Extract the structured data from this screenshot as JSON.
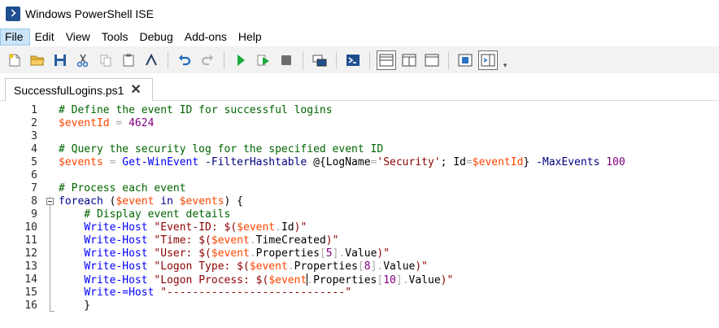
{
  "window": {
    "title": "Windows PowerShell ISE"
  },
  "menu": [
    "File",
    "Edit",
    "View",
    "Tools",
    "Debug",
    "Add-ons",
    "Help"
  ],
  "toolbar": {
    "buttons": [
      {
        "name": "new-icon"
      },
      {
        "name": "open-icon"
      },
      {
        "name": "save-icon"
      },
      {
        "name": "cut-icon"
      },
      {
        "name": "copy-icon"
      },
      {
        "name": "paste-icon"
      },
      {
        "name": "clear-console-icon"
      },
      {
        "name": "undo-icon"
      },
      {
        "name": "redo-icon"
      },
      {
        "name": "run-script-icon"
      },
      {
        "name": "run-selection-icon"
      },
      {
        "name": "stop-icon"
      },
      {
        "name": "remote-powershell-icon"
      },
      {
        "name": "start-powershell-icon"
      },
      {
        "name": "show-script-pane-top-icon"
      },
      {
        "name": "show-script-pane-right-icon"
      },
      {
        "name": "show-script-pane-maximized-icon"
      },
      {
        "name": "show-script-pane-icon"
      },
      {
        "name": "show-command-addon-icon"
      }
    ],
    "colors": {
      "run": "#1aa83b",
      "stop": "#6d6d6d",
      "save": "#2a5d9e",
      "undo": "#1f6bb8"
    }
  },
  "tabs": [
    {
      "label": "SuccessfulLogins.ps1",
      "close": "✕"
    }
  ],
  "editor": {
    "lines": [
      {
        "n": "1",
        "tokens": [
          {
            "t": "# Define the event ID for successful logins",
            "c": "comment"
          }
        ]
      },
      {
        "n": "2",
        "tokens": [
          {
            "t": "$eventId",
            "c": "var"
          },
          {
            "t": " ",
            "c": "plain"
          },
          {
            "t": "=",
            "c": "op"
          },
          {
            "t": " ",
            "c": "plain"
          },
          {
            "t": "4624",
            "c": "num"
          }
        ]
      },
      {
        "n": "3",
        "tokens": []
      },
      {
        "n": "4",
        "tokens": [
          {
            "t": "# Query the security log for the specified event ID",
            "c": "comment"
          }
        ]
      },
      {
        "n": "5",
        "tokens": [
          {
            "t": "$events",
            "c": "var"
          },
          {
            "t": " ",
            "c": "plain"
          },
          {
            "t": "=",
            "c": "op"
          },
          {
            "t": " ",
            "c": "plain"
          },
          {
            "t": "Get-WinEvent",
            "c": "cmd"
          },
          {
            "t": " ",
            "c": "plain"
          },
          {
            "t": "-FilterHashtable",
            "c": "param"
          },
          {
            "t": " @{",
            "c": "plain"
          },
          {
            "t": "LogName",
            "c": "plain"
          },
          {
            "t": "=",
            "c": "op"
          },
          {
            "t": "'Security'",
            "c": "str"
          },
          {
            "t": "; ",
            "c": "plain"
          },
          {
            "t": "Id",
            "c": "plain"
          },
          {
            "t": "=",
            "c": "op"
          },
          {
            "t": "$eventId",
            "c": "var"
          },
          {
            "t": "} ",
            "c": "plain"
          },
          {
            "t": "-MaxEvents",
            "c": "param"
          },
          {
            "t": " ",
            "c": "plain"
          },
          {
            "t": "100",
            "c": "num"
          }
        ]
      },
      {
        "n": "6",
        "tokens": []
      },
      {
        "n": "7",
        "tokens": [
          {
            "t": "# Process each event",
            "c": "comment"
          }
        ]
      },
      {
        "n": "8",
        "tokens": [
          {
            "t": "foreach",
            "c": "kw"
          },
          {
            "t": " (",
            "c": "plain"
          },
          {
            "t": "$event",
            "c": "var"
          },
          {
            "t": " ",
            "c": "plain"
          },
          {
            "t": "in",
            "c": "kw"
          },
          {
            "t": " ",
            "c": "plain"
          },
          {
            "t": "$events",
            "c": "var"
          },
          {
            "t": ") {",
            "c": "plain"
          }
        ]
      },
      {
        "n": "9",
        "tokens": [
          {
            "t": "    # Display event details",
            "c": "comment"
          }
        ]
      },
      {
        "n": "10",
        "tokens": [
          {
            "t": "    ",
            "c": "plain"
          },
          {
            "t": "Write-Host",
            "c": "cmd"
          },
          {
            "t": " ",
            "c": "plain"
          },
          {
            "t": "\"Event-ID: $(",
            "c": "str"
          },
          {
            "t": "$event",
            "c": "var"
          },
          {
            "t": ".",
            "c": "op"
          },
          {
            "t": "Id",
            "c": "member"
          },
          {
            "t": ")\"",
            "c": "str"
          }
        ]
      },
      {
        "n": "11",
        "tokens": [
          {
            "t": "    ",
            "c": "plain"
          },
          {
            "t": "Write-Host",
            "c": "cmd"
          },
          {
            "t": " ",
            "c": "plain"
          },
          {
            "t": "\"Time: $(",
            "c": "str"
          },
          {
            "t": "$event",
            "c": "var"
          },
          {
            "t": ".",
            "c": "op"
          },
          {
            "t": "TimeCreated",
            "c": "member"
          },
          {
            "t": ")\"",
            "c": "str"
          }
        ]
      },
      {
        "n": "12",
        "tokens": [
          {
            "t": "    ",
            "c": "plain"
          },
          {
            "t": "Write-Host",
            "c": "cmd"
          },
          {
            "t": " ",
            "c": "plain"
          },
          {
            "t": "\"User: $(",
            "c": "str"
          },
          {
            "t": "$event",
            "c": "var"
          },
          {
            "t": ".",
            "c": "op"
          },
          {
            "t": "Properties",
            "c": "member"
          },
          {
            "t": "[",
            "c": "op"
          },
          {
            "t": "5",
            "c": "num"
          },
          {
            "t": "]",
            "c": "op"
          },
          {
            "t": ".",
            "c": "op"
          },
          {
            "t": "Value",
            "c": "member"
          },
          {
            "t": ")\"",
            "c": "str"
          }
        ]
      },
      {
        "n": "13",
        "tokens": [
          {
            "t": "    ",
            "c": "plain"
          },
          {
            "t": "Write-Host",
            "c": "cmd"
          },
          {
            "t": " ",
            "c": "plain"
          },
          {
            "t": "\"Logon Type: $(",
            "c": "str"
          },
          {
            "t": "$event",
            "c": "var"
          },
          {
            "t": ".",
            "c": "op"
          },
          {
            "t": "Properties",
            "c": "member"
          },
          {
            "t": "[",
            "c": "op"
          },
          {
            "t": "8",
            "c": "num"
          },
          {
            "t": "]",
            "c": "op"
          },
          {
            "t": ".",
            "c": "op"
          },
          {
            "t": "Value",
            "c": "member"
          },
          {
            "t": ")\"",
            "c": "str"
          }
        ]
      },
      {
        "n": "14",
        "tokens": [
          {
            "t": "    ",
            "c": "plain"
          },
          {
            "t": "Write-Host",
            "c": "cmd"
          },
          {
            "t": " ",
            "c": "plain"
          },
          {
            "t": "\"Logon Process: $(",
            "c": "str"
          },
          {
            "t": "$event",
            "c": "var"
          },
          {
            "t": "|",
            "c": "caret"
          },
          {
            "t": ".",
            "c": "op"
          },
          {
            "t": "Properties",
            "c": "member"
          },
          {
            "t": "[",
            "c": "op"
          },
          {
            "t": "10",
            "c": "num"
          },
          {
            "t": "]",
            "c": "op"
          },
          {
            "t": ".",
            "c": "op"
          },
          {
            "t": "Value",
            "c": "member"
          },
          {
            "t": ")\"",
            "c": "str"
          }
        ]
      },
      {
        "n": "15",
        "tokens": [
          {
            "t": "    ",
            "c": "plain"
          },
          {
            "t": "Write-=Host",
            "c": "cmd"
          },
          {
            "t": " ",
            "c": "plain"
          },
          {
            "t": "\"----------------------------\"",
            "c": "str"
          }
        ]
      },
      {
        "n": "16",
        "tokens": [
          {
            "t": "    }",
            "c": "plain"
          }
        ]
      }
    ]
  }
}
